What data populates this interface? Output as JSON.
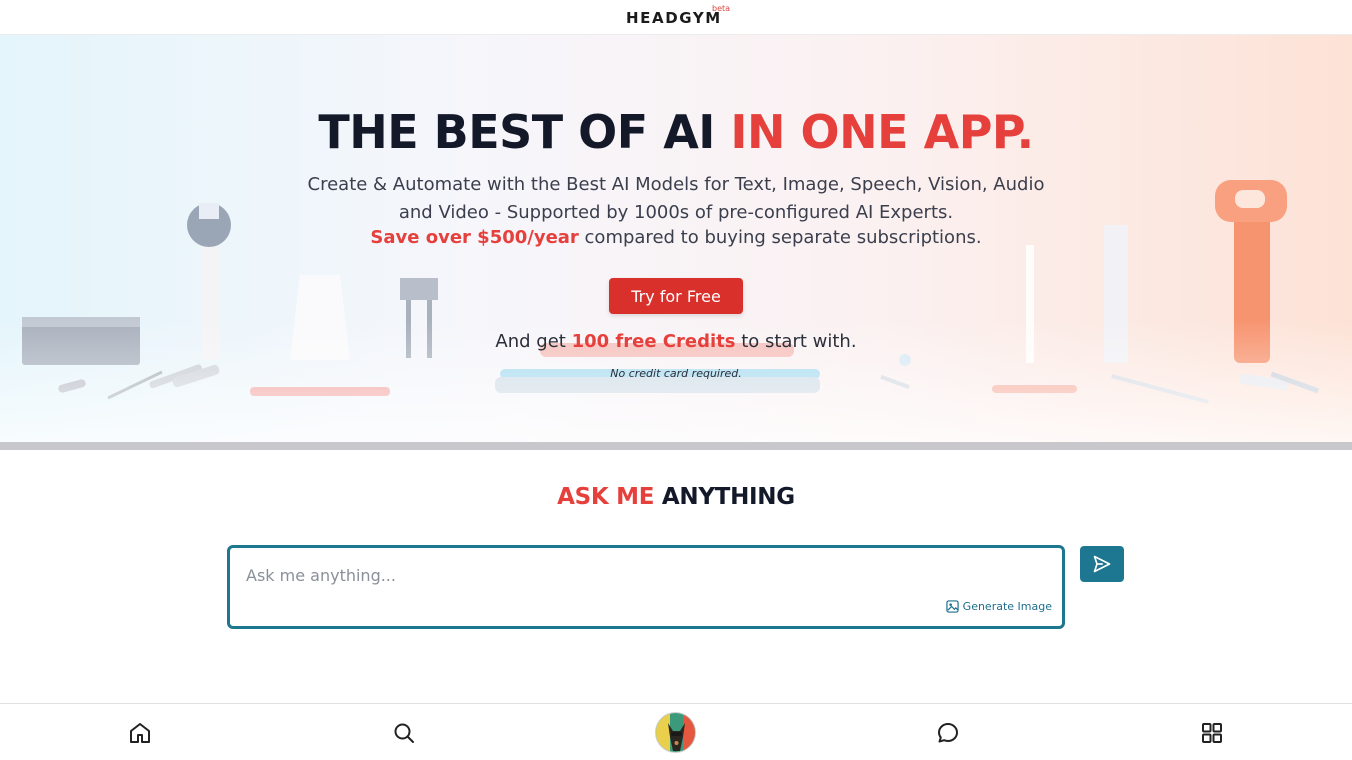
{
  "header": {
    "logo_text": "HEADGYM",
    "logo_badge": "beta"
  },
  "hero": {
    "title_main": "THE BEST OF AI ",
    "title_accent": "IN ONE APP.",
    "subtitle": "Create & Automate with the Best AI Models for Text, Image, Speech, Vision, Audio and Video - Supported by 1000s of pre-configured AI Experts.",
    "save_accent": "Save over $500/year",
    "save_rest": " compared to buying separate subscriptions.",
    "cta_label": "Try for Free",
    "credits_prefix": "And get ",
    "credits_accent": "100 free Credits",
    "credits_suffix": " to start with.",
    "no_card": "No credit card required."
  },
  "ask": {
    "title_accent": "ASK ME",
    "title_rest": " ANYTHING",
    "placeholder": "Ask me anything...",
    "generate_image_label": "Generate Image"
  },
  "bottom_nav": {
    "items": [
      {
        "name": "home",
        "icon": "home-icon"
      },
      {
        "name": "search",
        "icon": "search-icon"
      },
      {
        "name": "avatar",
        "icon": "avatar"
      },
      {
        "name": "chat",
        "icon": "chat-bubble-icon"
      },
      {
        "name": "apps",
        "icon": "grid-icon"
      }
    ]
  },
  "colors": {
    "accent_red": "#e6403d",
    "cta_red": "#d9302c",
    "teal": "#1e7791",
    "dark_text": "#14192a"
  }
}
